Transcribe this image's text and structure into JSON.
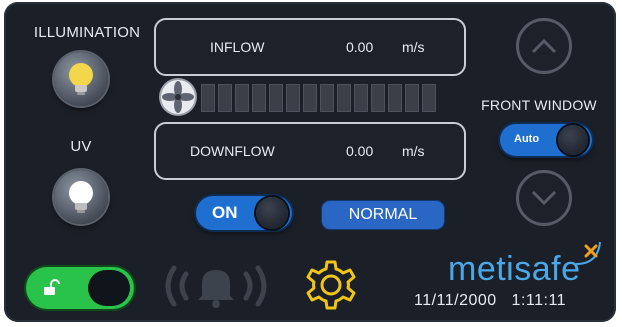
{
  "illumination": {
    "label": "ILLUMINATION"
  },
  "uv": {
    "label": "UV"
  },
  "inflow": {
    "label": "INFLOW",
    "value": "0.00",
    "unit": "m/s"
  },
  "downflow": {
    "label": "DOWNFLOW",
    "value": "0.00",
    "unit": "m/s"
  },
  "fan": {
    "level_bars_total": 14,
    "level_bars_lit": 0
  },
  "power_toggle": {
    "label": "ON"
  },
  "status": {
    "text": "NORMAL"
  },
  "front_window": {
    "label": "FRONT WINDOW",
    "mode_label": "Auto"
  },
  "brand": {
    "name": "metisafe"
  },
  "clock": {
    "text": "11/11/2000   1:11:11"
  },
  "icons": [
    "bulb-on-icon",
    "bulb-off-icon",
    "fan-icon",
    "chevron-up-icon",
    "chevron-down-icon",
    "unlock-icon",
    "alarm-bell-icon",
    "gear-icon"
  ],
  "colors": {
    "accent_blue": "#1f6fd0",
    "lock_green": "#29c24a",
    "bulb_yellow": "#f2d64b",
    "gear_yellow": "#f0c419",
    "logo_blue": "#4aa8e8"
  }
}
